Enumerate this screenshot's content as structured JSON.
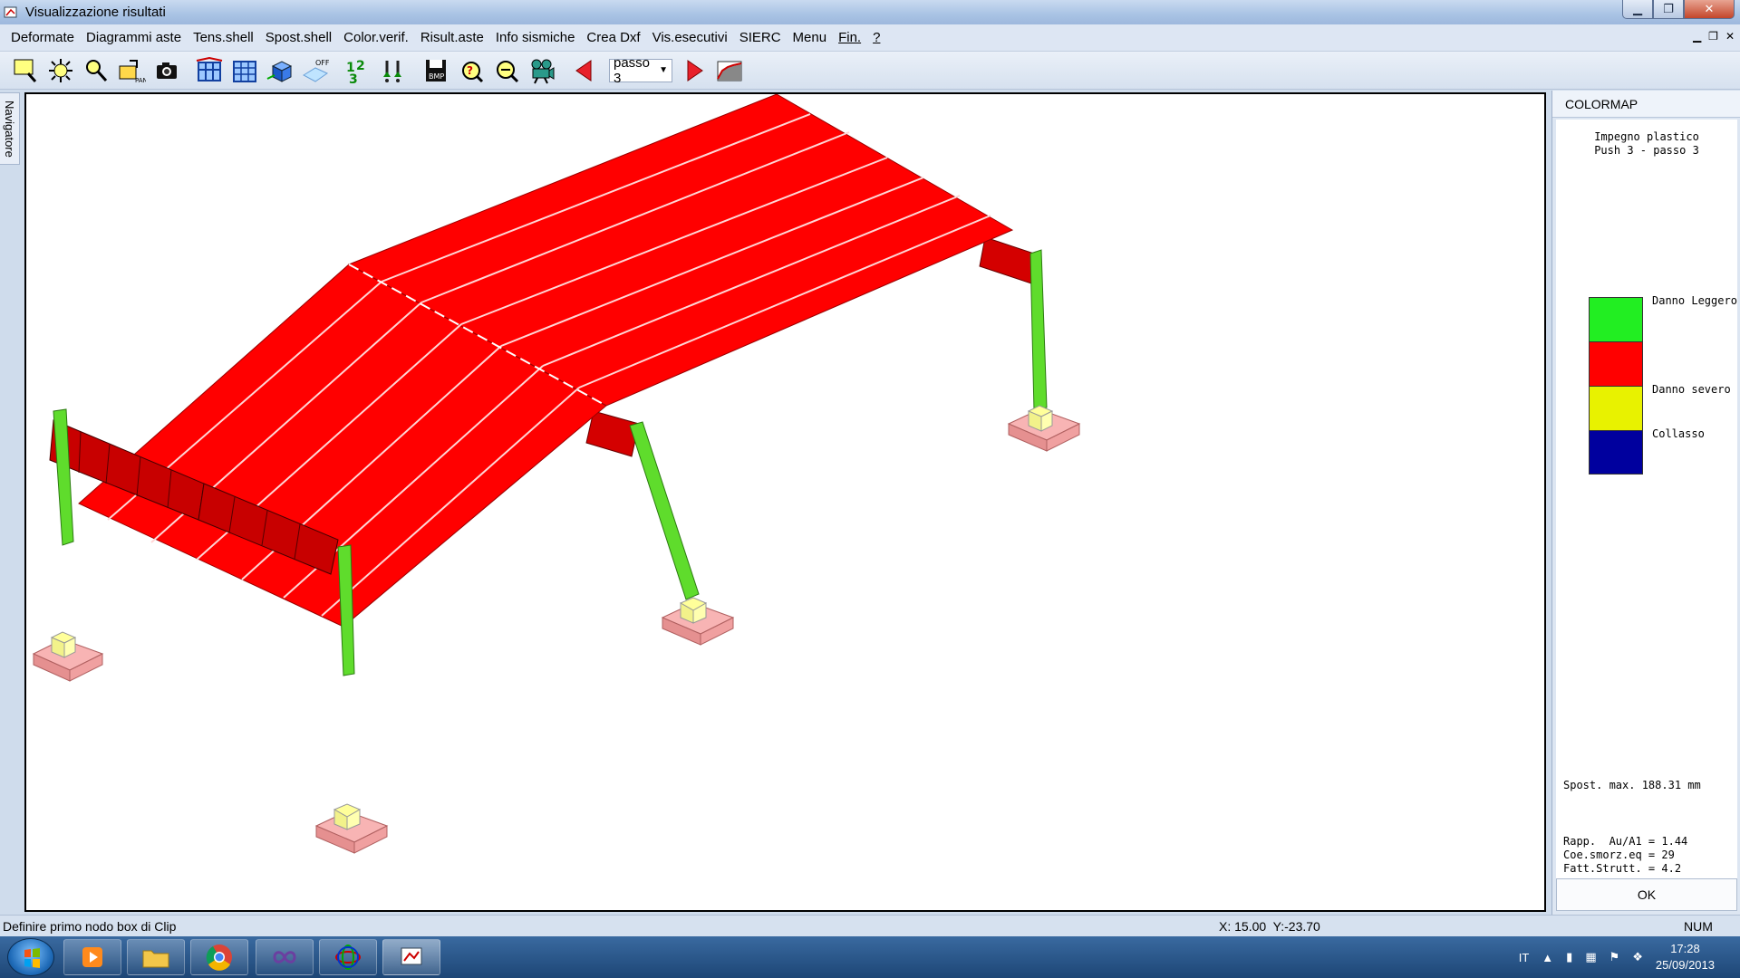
{
  "window": {
    "title": "Visualizzazione risultati"
  },
  "menu": {
    "items": [
      "Deformate",
      "Diagrammi aste",
      "Tens.shell",
      "Spost.shell",
      "Color.verif.",
      "Risult.aste",
      "Info sismiche",
      "Crea Dxf",
      "Vis.esecutivi",
      "SIERC",
      "Menu",
      "Fin.",
      "?"
    ]
  },
  "toolbar": {
    "step_select": "passo 3"
  },
  "navigator": {
    "label": "Navigatore"
  },
  "colormap": {
    "header": "COLORMAP",
    "title_line1": "Impegno plastico",
    "title_line2": "Push 3 - passo 3",
    "legend": [
      {
        "color": "#22ee22",
        "label": "Danno Leggero"
      },
      {
        "color": "#ff0000",
        "label": ""
      },
      {
        "color": "#e8f200",
        "label": "Danno severo"
      },
      {
        "color": "#00009e",
        "label": "Collasso"
      }
    ],
    "spost_max": "Spost. max. 188.31 mm",
    "rapp": "Rapp.  Au/A1 = 1.44",
    "coe": "Coe.smorz.eq = 29",
    "fatt": "Fatt.Strutt. = 4.2",
    "ok_label": "OK"
  },
  "status": {
    "message": "Definire primo nodo box di Clip",
    "coords": "X: 15.00  Y:-23.70",
    "num": "NUM"
  },
  "taskbar": {
    "lang": "IT",
    "time": "17:28",
    "date": "25/09/2013"
  },
  "colors": {
    "roof": "#ff0000",
    "column": "#5fdc2c",
    "plinth": "#f8b4b4",
    "pedestal": "#ffff9a"
  }
}
